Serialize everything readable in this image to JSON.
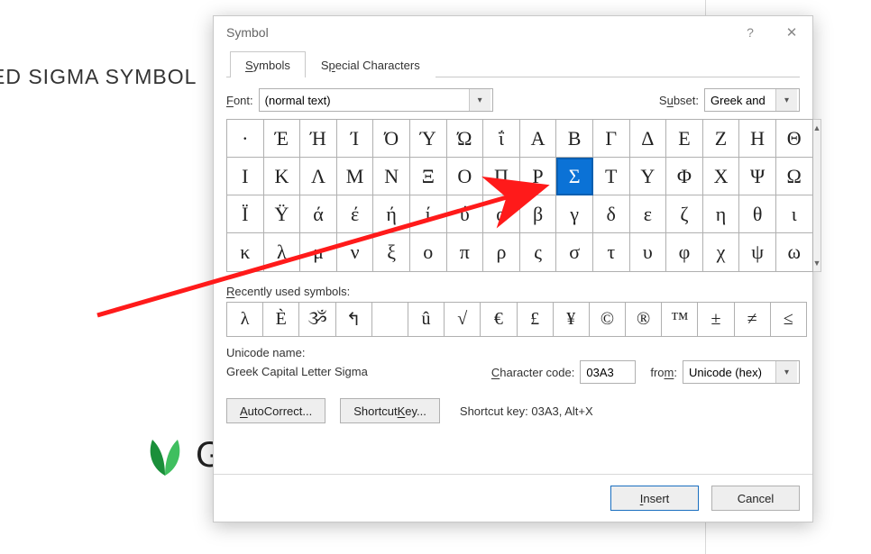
{
  "background": {
    "heading_fragment": "ED SIGMA SYMBOL",
    "logo_text_fragment": "G"
  },
  "dialog": {
    "title": "Symbol",
    "tabs": {
      "symbols": "Symbols",
      "special": "Special Characters"
    },
    "font": {
      "label": "Font:",
      "value": "(normal text)"
    },
    "subset": {
      "label": "Subset:",
      "value": "Greek and"
    },
    "grid": [
      [
        "·",
        "Έ",
        "Ή",
        "Ί",
        "Ό",
        "Ύ",
        "Ώ",
        "ΐ",
        "Α",
        "Β",
        "Γ",
        "Δ",
        "Ε",
        "Ζ",
        "Η",
        "Θ"
      ],
      [
        "Ι",
        "Κ",
        "Λ",
        "Μ",
        "Ν",
        "Ξ",
        "Ο",
        "Π",
        "Ρ",
        "Σ",
        "Τ",
        "Υ",
        "Φ",
        "Χ",
        "Ψ",
        "Ω"
      ],
      [
        "Ϊ",
        "Ϋ",
        "ά",
        "έ",
        "ή",
        "ί",
        "ΰ",
        "α",
        "β",
        "γ",
        "δ",
        "ε",
        "ζ",
        "η",
        "θ",
        "ι"
      ],
      [
        "κ",
        "λ",
        "μ",
        "ν",
        "ξ",
        "ο",
        "π",
        "ρ",
        "ς",
        "σ",
        "τ",
        "υ",
        "φ",
        "χ",
        "ψ",
        "ω"
      ]
    ],
    "selected": {
      "row": 1,
      "col": 9
    },
    "recent_label": "Recently used symbols:",
    "recent": [
      "λ",
      "È",
      "ૐ",
      "↰",
      "",
      "û",
      "√",
      "€",
      "£",
      "¥",
      "©",
      "®",
      "™",
      "±",
      "≠",
      "≤"
    ],
    "unicode_name_label": "Unicode name:",
    "unicode_name_value": "Greek Capital Letter Sigma",
    "char_code_label": "Character code:",
    "char_code_value": "03A3",
    "from_label": "from:",
    "from_value": "Unicode (hex)",
    "autocorrect_btn": "AutoCorrect...",
    "shortcut_key_btn": "Shortcut Key...",
    "shortcut_text": "Shortcut key: 03A3, Alt+X",
    "insert_btn": "Insert",
    "cancel_btn": "Cancel"
  }
}
